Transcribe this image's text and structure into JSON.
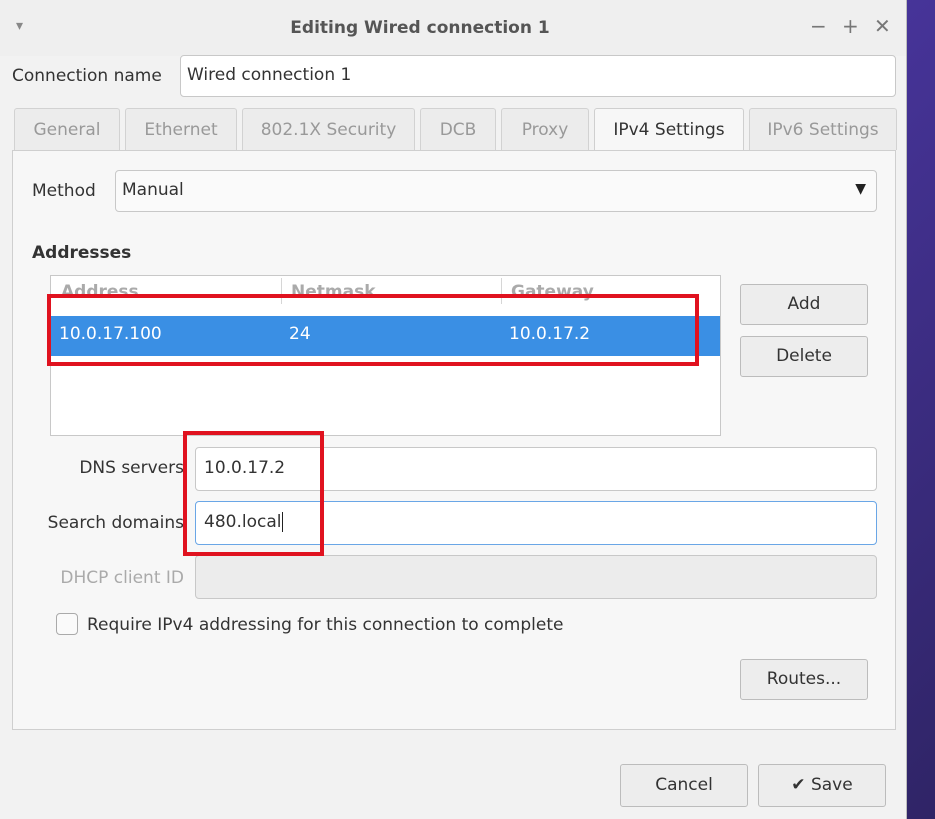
{
  "window": {
    "title": "Editing Wired connection 1",
    "controls": {
      "menu": "▾",
      "minimize": "−",
      "maximize": "+",
      "close": "✕"
    }
  },
  "connection": {
    "label": "Connection name",
    "value": "Wired connection 1"
  },
  "tabs": [
    {
      "label": "General"
    },
    {
      "label": "Ethernet"
    },
    {
      "label": "802.1X Security"
    },
    {
      "label": "DCB"
    },
    {
      "label": "Proxy"
    },
    {
      "label": "IPv4 Settings",
      "active": true
    },
    {
      "label": "IPv6 Settings"
    }
  ],
  "ipv4": {
    "method_label": "Method",
    "method_value": "Manual",
    "addresses_heading": "Addresses",
    "columns": [
      "Address",
      "Netmask",
      "Gateway"
    ],
    "rows": [
      {
        "address": "10.0.17.100",
        "netmask": "24",
        "gateway": "10.0.17.2",
        "selected": true
      }
    ],
    "add_label": "Add",
    "delete_label": "Delete",
    "dns_label": "DNS servers",
    "dns_value": "10.0.17.2",
    "search_label": "Search domains",
    "search_value": "480.local",
    "dhcp_label": "DHCP client ID",
    "dhcp_value": "",
    "require_label": "Require IPv4 addressing for this connection to complete",
    "require_checked": false,
    "routes_label": "Routes..."
  },
  "footer": {
    "cancel_label": "Cancel",
    "save_label": "Save",
    "save_icon": "✔"
  },
  "colors": {
    "selection": "#3a8fe4",
    "annotation": "#e0121f"
  }
}
